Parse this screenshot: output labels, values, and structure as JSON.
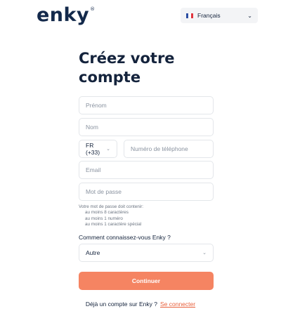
{
  "brand": {
    "name": "enky",
    "mark": "®"
  },
  "language": {
    "selected": "Français",
    "flag": "fr-flag"
  },
  "form": {
    "title": "Créez votre compte",
    "first_name_placeholder": "Prénom",
    "last_name_placeholder": "Nom",
    "phone_prefix": "FR (+33)",
    "phone_placeholder": "Numéro de téléphone",
    "email_placeholder": "Email",
    "password_placeholder": "Mot de passe",
    "password_hint": {
      "title": "Votre mot de passe doit contenir:",
      "rules": [
        "au moins 8 caractères",
        "au moins 1 numéro",
        "au moins 1 caractère spécial"
      ]
    },
    "source_question": "Comment connaissez-vous Enky ?",
    "source_selected": "Autre",
    "submit_label": "Continuer"
  },
  "footer": {
    "has_account_text": "Déjà un compte sur Enky ?",
    "login_link": "Se connecter"
  },
  "colors": {
    "primary": "#f58462",
    "text": "#14233c",
    "link": "#e8603c"
  }
}
